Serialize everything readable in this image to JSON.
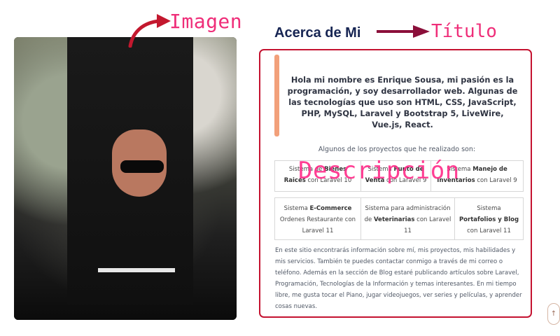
{
  "annotations": {
    "imagen": "Imagen",
    "titulo": "Título",
    "descripcion": "Descripción"
  },
  "about": {
    "title": "Acerca de Mi",
    "intro": "Hola mi nombre es Enrique Sousa, mi pasión es la programación, y soy desarrollador web. Algunas de las tecnologías que uso son HTML, CSS, JavaScript, PHP, MySQL, Laravel y Bootstrap 5, LiveWire, Vue.js, React.",
    "projects_caption": "Algunos de los proyectos que he realizado son:",
    "projects": [
      {
        "prefix": "Sistema de ",
        "bold": "Bienes Raices",
        "suffix": " con Laravel 10"
      },
      {
        "prefix": "Sistema ",
        "bold": "Punto de Venta",
        "suffix": " con Laravel 9"
      },
      {
        "prefix": "Sistema ",
        "bold": "Manejo de Inventarios",
        "suffix": " con Laravel 9"
      },
      {
        "prefix": "Sistema ",
        "bold": "E-Commerce",
        "suffix": " Ordenes Restaurante con Laravel 11"
      },
      {
        "prefix": "Sistema para administración de ",
        "bold": "Veterinarias",
        "suffix": " con Laravel 11"
      },
      {
        "prefix": "Sistema ",
        "bold": "Portafolios y Blog",
        "suffix": "  con Laravel 11"
      }
    ],
    "description": "En este sitio encontrarás información sobre mí, mis proyectos, mis habilidades y mis servicios. También te puedes contactar conmigo a través de mi correo o teléfono. Además en la sección de Blog estaré publicando artículos sobre Laravel, Programación, Tecnologías de la Información y temas interesantes. En mi tiempo libre, me gusta tocar el Piano, jugar videojuegos, ver series y películas, y aprender cosas nuevas."
  },
  "ui": {
    "scroll_top_icon": "arrow-up-icon",
    "scroll_top_glyph": "↑",
    "accent_color": "#c41230",
    "annotation_color": "#ef2e79"
  }
}
